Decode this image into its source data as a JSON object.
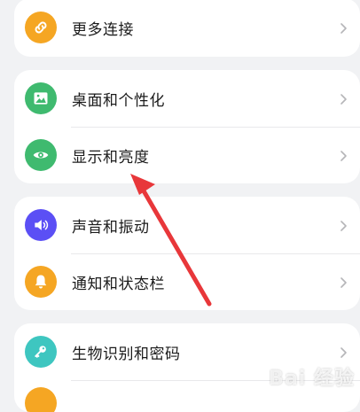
{
  "cards": [
    {
      "items": [
        {
          "label": "更多连接",
          "icon": "link-icon",
          "color": "#f5a623"
        }
      ]
    },
    {
      "items": [
        {
          "label": "桌面和个性化",
          "icon": "wallpaper-icon",
          "color": "#3fba6f"
        },
        {
          "label": "显示和亮度",
          "icon": "eye-icon",
          "color": "#3fba6f"
        }
      ]
    },
    {
      "items": [
        {
          "label": "声音和振动",
          "icon": "speaker-icon",
          "color": "#5b4ff5"
        },
        {
          "label": "通知和状态栏",
          "icon": "bell-icon",
          "color": "#f5a623"
        }
      ]
    },
    {
      "items": [
        {
          "label": "生物识别和密码",
          "icon": "key-icon",
          "color": "#3ec6c0"
        }
      ]
    }
  ],
  "annotation_arrow_color": "#e8373a",
  "watermark": "Bai 经验"
}
